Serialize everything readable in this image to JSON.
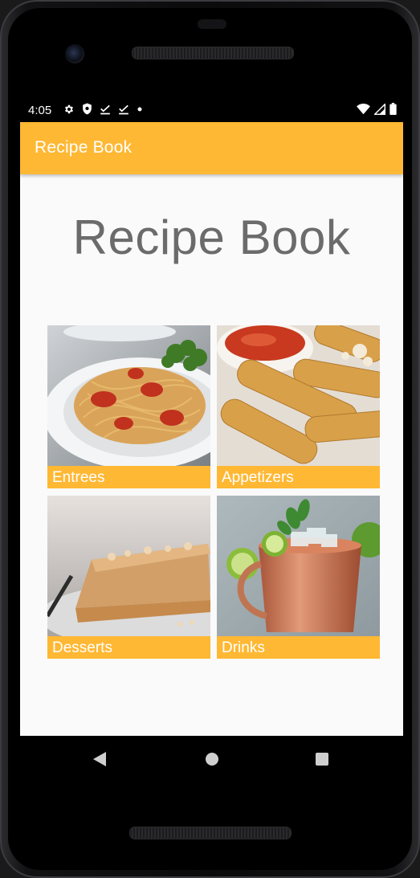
{
  "status_bar": {
    "time": "4:05",
    "icons_left": [
      "settings-icon",
      "shield-icon",
      "download-done-icon",
      "download-done-icon",
      "notification-dot-icon"
    ],
    "icons_right": [
      "wifi-icon",
      "signal-icon",
      "battery-icon"
    ]
  },
  "app_bar": {
    "title": "Recipe Book",
    "color": "#FFB833"
  },
  "main": {
    "heading": "Recipe Book",
    "categories": [
      {
        "label": "Entrees",
        "image": "spaghetti-photo"
      },
      {
        "label": "Appetizers",
        "image": "mozzarella-sticks-photo"
      },
      {
        "label": "Desserts",
        "image": "pie-slice-photo"
      },
      {
        "label": "Drinks",
        "image": "moscow-mule-photo"
      }
    ]
  },
  "nav_bar": {
    "buttons": [
      "back-icon",
      "home-icon",
      "recents-icon"
    ]
  }
}
